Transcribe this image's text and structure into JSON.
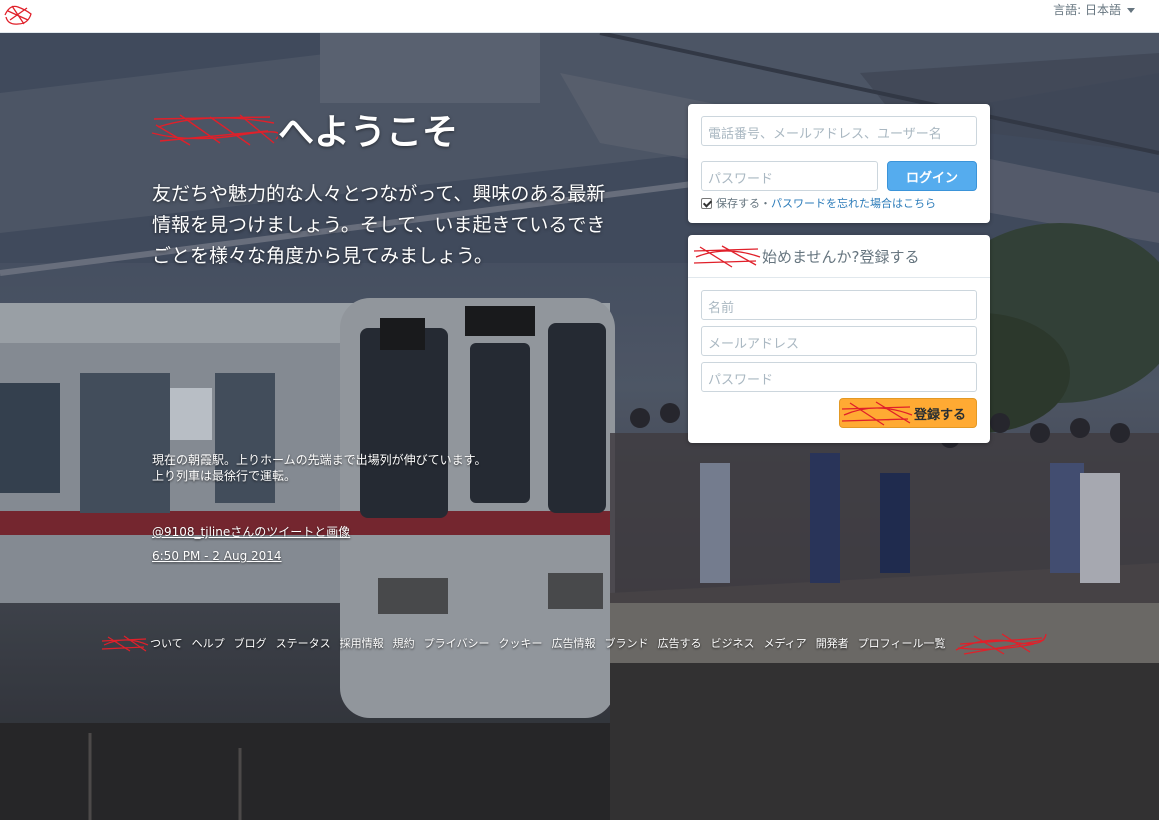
{
  "topbar": {
    "language_label": "言語: 日本語"
  },
  "hero": {
    "welcome_suffix": "へようこそ",
    "tagline": "友だちや魅力的な人々とつながって、興味のある最新情報を見つけましょう。そして、いま起きているできごとを様々な角度から見てみましょう。",
    "photo_caption_line1": "現在の朝霞駅。上りホームの先端まで出場列が伸びています。",
    "photo_caption_line2": "上り列車は最徐行で運転。",
    "attribution": "@9108_tjlineさんのツイートと画像",
    "timestamp": "6:50 PM - 2 Aug 2014"
  },
  "login": {
    "email_placeholder": "電話番号、メールアドレス、ユーザー名",
    "password_placeholder": "パスワード",
    "login_button": "ログイン",
    "remember_label": "保存する",
    "separator": "・",
    "forgot_link": "パスワードを忘れた場合はこちら"
  },
  "signup": {
    "heading_suffix": "始めませんか?",
    "heading_link": "登録する",
    "name_placeholder": "名前",
    "email_placeholder": "メールアドレス",
    "password_placeholder": "パスワード",
    "submit_suffix": "登録する"
  },
  "footer": {
    "links": [
      "ついて",
      "ヘルプ",
      "ブログ",
      "ステータス",
      "採用情報",
      "規約",
      "プライバシー",
      "クッキー",
      "広告情報",
      "ブランド",
      "広告する",
      "ビジネス",
      "メディア",
      "開発者",
      "プロフィール一覧"
    ]
  },
  "colors": {
    "login_button": "#55acee",
    "signup_button": "#ffaa33",
    "link": "#2b7bb9",
    "redaction": "#e0202a"
  }
}
